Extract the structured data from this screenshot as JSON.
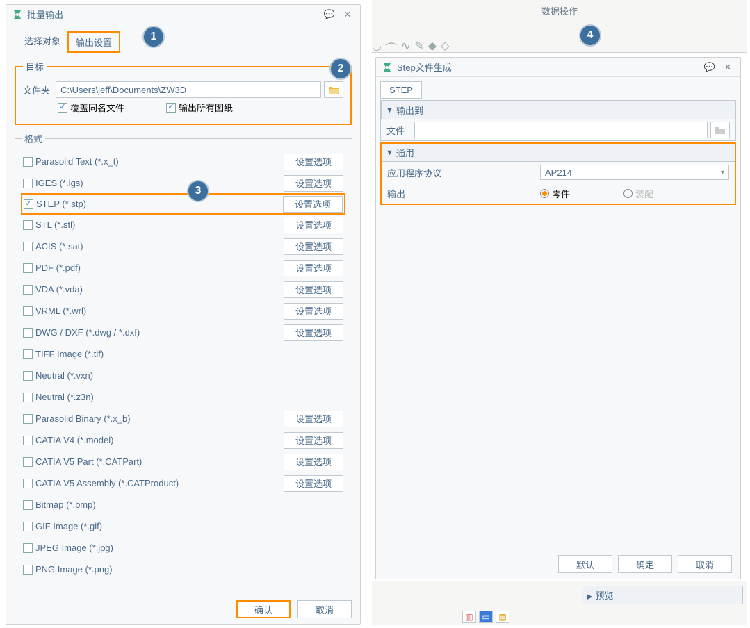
{
  "toolbar_header": "数据操作",
  "dlg1": {
    "title": "批量输出",
    "tabs": {
      "select_obj": "选择对象",
      "output_settings": "输出设置"
    },
    "target": {
      "legend": "目标",
      "folder_label": "文件夹",
      "folder_value": "C:\\Users\\jeff\\Documents\\ZW3D",
      "overwrite": "覆盖同名文件",
      "export_all": "输出所有图纸"
    },
    "format_legend": "格式",
    "opt_btn": "设置选项",
    "formats": [
      {
        "name": "Parasolid Text (*.x_t)",
        "checked": false,
        "has_btn": true,
        "sel": false
      },
      {
        "name": "IGES (*.igs)",
        "checked": false,
        "has_btn": true,
        "sel": false
      },
      {
        "name": "STEP (*.stp)",
        "checked": true,
        "has_btn": true,
        "sel": true
      },
      {
        "name": "STL (*.stl)",
        "checked": false,
        "has_btn": true,
        "sel": false
      },
      {
        "name": "ACIS (*.sat)",
        "checked": false,
        "has_btn": true,
        "sel": false
      },
      {
        "name": "PDF (*.pdf)",
        "checked": false,
        "has_btn": true,
        "sel": false
      },
      {
        "name": "VDA (*.vda)",
        "checked": false,
        "has_btn": true,
        "sel": false
      },
      {
        "name": "VRML (*.wrl)",
        "checked": false,
        "has_btn": true,
        "sel": false
      },
      {
        "name": "DWG / DXF (*.dwg / *.dxf)",
        "checked": false,
        "has_btn": true,
        "sel": false
      },
      {
        "name": "TIFF Image (*.tif)",
        "checked": false,
        "has_btn": false,
        "sel": false
      },
      {
        "name": "Neutral (*.vxn)",
        "checked": false,
        "has_btn": false,
        "sel": false
      },
      {
        "name": "Neutral (*.z3n)",
        "checked": false,
        "has_btn": false,
        "sel": false
      },
      {
        "name": "Parasolid Binary (*.x_b)",
        "checked": false,
        "has_btn": true,
        "sel": false
      },
      {
        "name": "CATIA V4 (*.model)",
        "checked": false,
        "has_btn": true,
        "sel": false
      },
      {
        "name": "CATIA V5 Part (*.CATPart)",
        "checked": false,
        "has_btn": true,
        "sel": false
      },
      {
        "name": "CATIA V5 Assembly (*.CATProduct)",
        "checked": false,
        "has_btn": true,
        "sel": false
      },
      {
        "name": "Bitmap (*.bmp)",
        "checked": false,
        "has_btn": false,
        "sel": false
      },
      {
        "name": "GIF Image (*.gif)",
        "checked": false,
        "has_btn": false,
        "sel": false
      },
      {
        "name": "JPEG Image (*.jpg)",
        "checked": false,
        "has_btn": false,
        "sel": false
      },
      {
        "name": "PNG Image (*.png)",
        "checked": false,
        "has_btn": false,
        "sel": false
      }
    ],
    "ok": "确认",
    "cancel": "取消"
  },
  "dlg2": {
    "title": "Step文件生成",
    "tab": "STEP",
    "export_to": "输出到",
    "file_label": "文件",
    "general": "通用",
    "protocol_label": "应用程序协议",
    "protocol_value": "AP214",
    "output_label": "输出",
    "radio_part": "零件",
    "radio_asm": "装配",
    "default_btn": "默认",
    "ok": "确定",
    "cancel": "取消"
  },
  "preview": "预览",
  "bubbles": {
    "b1": "1",
    "b2": "2",
    "b3": "3",
    "b4": "4"
  }
}
